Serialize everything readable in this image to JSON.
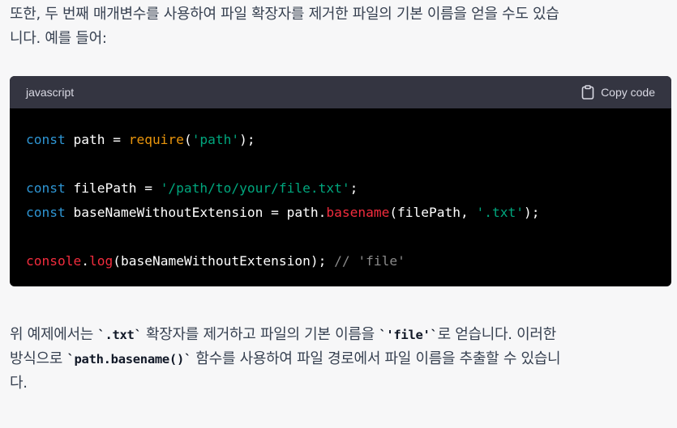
{
  "intro": {
    "line1": "또한, 두 번째 매개변수를 사용하여 파일 확장자를 제거한 파일의 기본 이름을 얻을 수도 있습",
    "line2": "니다. 예를 들어:"
  },
  "code_block": {
    "language": "javascript",
    "copy_label": "Copy code",
    "lines": [
      [
        {
          "t": "const",
          "c": "kw"
        },
        {
          "t": " path = ",
          "c": "pl"
        },
        {
          "t": "require",
          "c": "req"
        },
        {
          "t": "(",
          "c": "pl"
        },
        {
          "t": "'path'",
          "c": "str"
        },
        {
          "t": ");",
          "c": "pl"
        }
      ],
      [],
      [
        {
          "t": "const",
          "c": "kw"
        },
        {
          "t": " filePath = ",
          "c": "pl"
        },
        {
          "t": "'/path/to/your/file.txt'",
          "c": "str"
        },
        {
          "t": ";",
          "c": "pl"
        }
      ],
      [
        {
          "t": "const",
          "c": "kw"
        },
        {
          "t": " baseNameWithoutExtension = path.",
          "c": "pl"
        },
        {
          "t": "basename",
          "c": "fn"
        },
        {
          "t": "(filePath, ",
          "c": "pl"
        },
        {
          "t": "'.txt'",
          "c": "str"
        },
        {
          "t": ");",
          "c": "pl"
        }
      ],
      [],
      [
        {
          "t": "console",
          "c": "fn"
        },
        {
          "t": ".",
          "c": "pl"
        },
        {
          "t": "log",
          "c": "fn"
        },
        {
          "t": "(baseNameWithoutExtension); ",
          "c": "pl"
        },
        {
          "t": "// 'file'",
          "c": "cm"
        }
      ]
    ]
  },
  "outro": {
    "l1_a": "위 예제에서는 ",
    "l1_code1": "`.txt`",
    "l1_b": " 확장자를 제거하고 파일의 기본 이름을 ",
    "l1_code2": "`'file'`",
    "l1_c": "로 얻습니다. 이러한",
    "l2_a": "방식으로 ",
    "l2_code": "`path.basename()`",
    "l2_b": " 함수를 사용하여 파일 경로에서 파일 이름을 추출할 수 있습니",
    "l3": "다."
  },
  "colors": {
    "keyword": "#2e95d3",
    "function": "#f22c3d",
    "require": "#e9950c",
    "string": "#00a67d",
    "comment": "#8a8a8a",
    "code_bg": "#000000",
    "header_bg": "#343541",
    "page_bg": "#f7f7f8"
  },
  "icons": {
    "copy": "clipboard-icon"
  }
}
